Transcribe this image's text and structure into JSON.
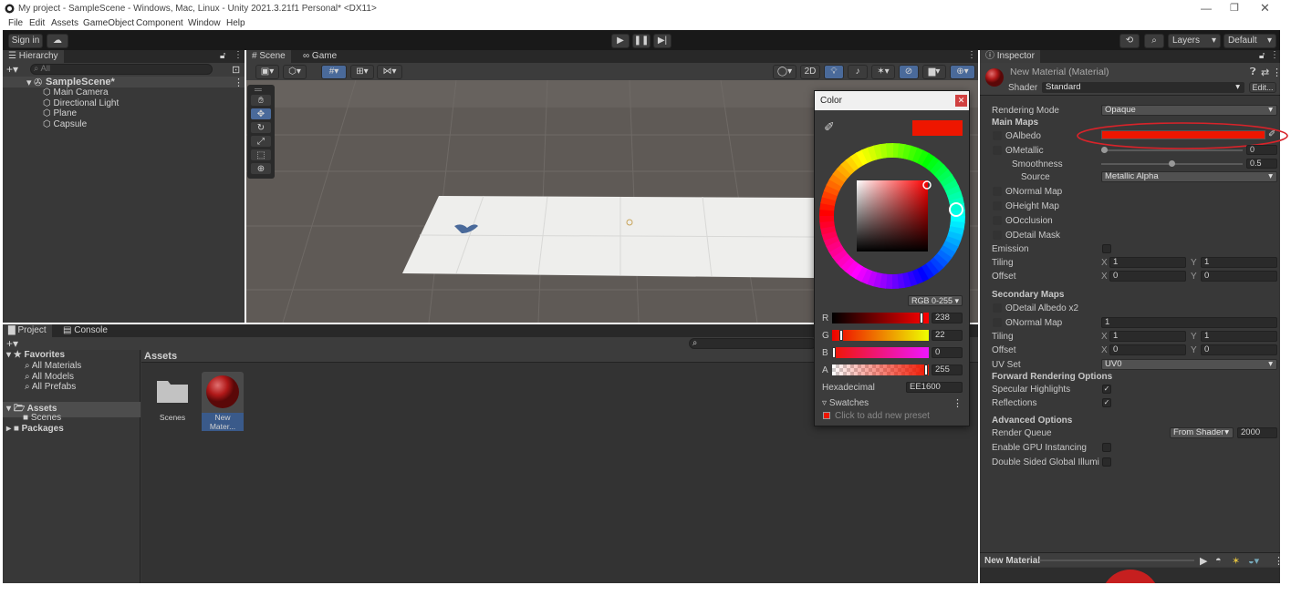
{
  "window": {
    "title": "My project - SampleScene - Windows, Mac, Linux - Unity 2021.3.21f1 Personal* <DX11>"
  },
  "menu": [
    "File",
    "Edit",
    "Assets",
    "GameObject",
    "Component",
    "Window",
    "Help"
  ],
  "toolbar": {
    "sign_in": "Sign in",
    "layers": "Layers",
    "layout": "Default"
  },
  "hierarchy": {
    "tab": "Hierarchy",
    "search_placeholder": "All",
    "scene": "SampleScene*",
    "objects": [
      "Main Camera",
      "Directional Light",
      "Plane",
      "Capsule"
    ]
  },
  "scene_view": {
    "tabs": [
      "Scene",
      "Game"
    ],
    "toggle_2d": "2D"
  },
  "color_picker": {
    "title": "Color",
    "mode": "RGB 0-255",
    "channels": [
      {
        "label": "R",
        "value": "238"
      },
      {
        "label": "G",
        "value": "22"
      },
      {
        "label": "B",
        "value": "0"
      },
      {
        "label": "A",
        "value": "255"
      }
    ],
    "hex_label": "Hexadecimal",
    "hex_value": "EE1600",
    "swatches_label": "Swatches",
    "swatch_hint": "Click to add new preset",
    "current_color": "#EE1600"
  },
  "project": {
    "tabs": [
      "Project",
      "Console"
    ],
    "favorites": {
      "label": "Favorites",
      "items": [
        "All Materials",
        "All Models",
        "All Prefabs"
      ]
    },
    "assets_root": "Assets",
    "assets_children": [
      "Scenes"
    ],
    "packages": "Packages",
    "breadcrumb": "Assets",
    "items": [
      {
        "name": "Scenes",
        "kind": "folder"
      },
      {
        "name": "New Mater...",
        "kind": "material"
      }
    ]
  },
  "inspector": {
    "tab": "Inspector",
    "object_name": "New Material (Material)",
    "shader_label": "Shader",
    "shader_value": "Standard",
    "edit_button": "Edit...",
    "rendering_mode_label": "Rendering Mode",
    "rendering_mode_value": "Opaque",
    "main_maps": "Main Maps",
    "albedo": "Albedo",
    "metallic": "Metallic",
    "metallic_value": "0",
    "smoothness": "Smoothness",
    "smoothness_value": "0.5",
    "source": "Source",
    "source_value": "Metallic Alpha",
    "normal_map": "Normal Map",
    "height_map": "Height Map",
    "occlusion": "Occlusion",
    "detail_mask": "Detail Mask",
    "emission": "Emission",
    "tiling": "Tiling",
    "offset": "Offset",
    "x": "X",
    "y": "Y",
    "tiling_x": "1",
    "tiling_y": "1",
    "offset_x": "0",
    "offset_y": "0",
    "secondary_maps": "Secondary Maps",
    "detail_albedo": "Detail Albedo x2",
    "sec_normal_map": "Normal Map",
    "sec_normal_value": "1",
    "sec_tiling_x": "1",
    "sec_tiling_y": "1",
    "sec_offset_x": "0",
    "sec_offset_y": "0",
    "uv_set": "UV Set",
    "uv_set_value": "UV0",
    "forward_options": "Forward Rendering Options",
    "specular": "Specular Highlights",
    "reflections": "Reflections",
    "advanced": "Advanced Options",
    "render_queue": "Render Queue",
    "render_queue_mode": "From Shader",
    "render_queue_value": "2000",
    "gpu_instancing": "Enable GPU Instancing",
    "double_sided": "Double Sided Global Illuminat",
    "preview_label": "New Material"
  }
}
